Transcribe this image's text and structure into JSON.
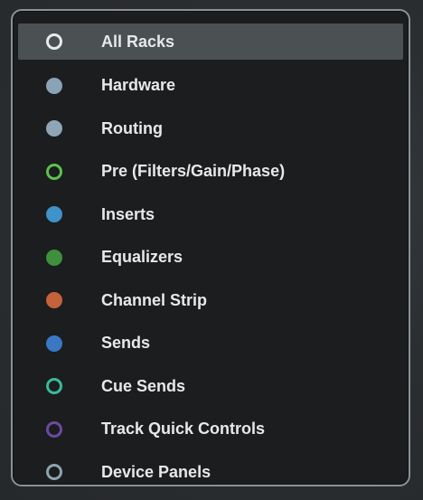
{
  "menu": {
    "items": [
      {
        "label": "All Racks",
        "icon": "circle-outline-icon",
        "color": "#e8eaec",
        "style": "ring",
        "selected": true
      },
      {
        "label": "Hardware",
        "icon": "circle-filled-icon",
        "color": "#8aa3b8",
        "style": "filled",
        "selected": false
      },
      {
        "label": "Routing",
        "icon": "circle-filled-icon",
        "color": "#8ea6b6",
        "style": "filled",
        "selected": false
      },
      {
        "label": "Pre (Filters/Gain/Phase)",
        "icon": "circle-outline-icon",
        "color": "#5cc24a",
        "style": "ring",
        "selected": false
      },
      {
        "label": "Inserts",
        "icon": "circle-filled-icon",
        "color": "#3e93c8",
        "style": "filled",
        "selected": false
      },
      {
        "label": "Equalizers",
        "icon": "circle-filled-icon",
        "color": "#3f8f3c",
        "style": "filled",
        "selected": false
      },
      {
        "label": "Channel Strip",
        "icon": "circle-filled-icon",
        "color": "#c4623a",
        "style": "filled",
        "selected": false
      },
      {
        "label": "Sends",
        "icon": "circle-filled-icon",
        "color": "#3a78c4",
        "style": "filled",
        "selected": false
      },
      {
        "label": "Cue Sends",
        "icon": "circle-outline-icon",
        "color": "#39b99a",
        "style": "ring",
        "selected": false
      },
      {
        "label": "Track Quick Controls",
        "icon": "circle-outline-icon",
        "color": "#6b4aa0",
        "style": "ring",
        "selected": false
      },
      {
        "label": "Device Panels",
        "icon": "circle-outline-icon",
        "color": "#8ea3b0",
        "style": "ring",
        "selected": false
      }
    ]
  }
}
